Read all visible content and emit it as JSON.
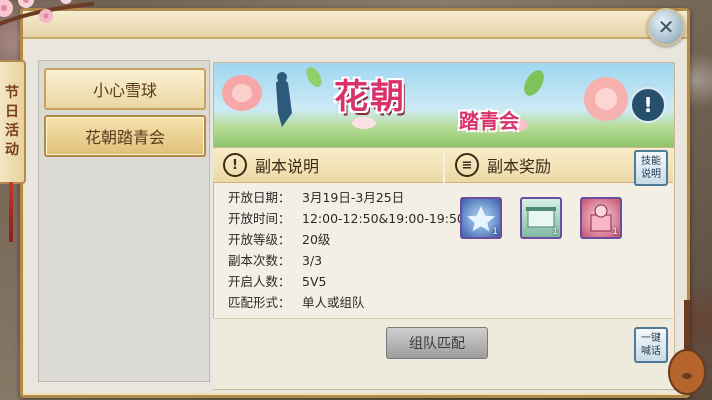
{
  "side_tab": {
    "chars": [
      "节",
      "日",
      "活",
      "动"
    ]
  },
  "list": {
    "items": [
      {
        "label": "小心雪球"
      },
      {
        "label": "花朝踏青会"
      }
    ],
    "selected_index": 1
  },
  "banner": {
    "title": "花朝",
    "subtitle": "踏青会"
  },
  "sections": {
    "description": {
      "label": "副本说明",
      "icon": "exclamation-icon"
    },
    "rewards": {
      "label": "副本奖励",
      "icon": "chest-icon"
    }
  },
  "skill_btn": {
    "label": "技能说明"
  },
  "info": [
    {
      "label": "开放日期：",
      "value": "3月19日-3月25日"
    },
    {
      "label": "开放时间：",
      "value": "12:00-12:50&19:00-19:50"
    },
    {
      "label": "开放等级：",
      "value": "20级"
    },
    {
      "label": "副本次数：",
      "value": "3/3"
    },
    {
      "label": "开启人数：",
      "value": "5V5"
    },
    {
      "label": "匹配形式：",
      "value": "单人或组队"
    }
  ],
  "rewards": [
    {
      "icon": "lotus-item-icon",
      "count": "1"
    },
    {
      "icon": "scroll-item-icon",
      "count": "1"
    },
    {
      "icon": "gift-item-icon",
      "count": "1"
    }
  ],
  "match_button": {
    "label": "组队匹配"
  },
  "quick_chat": {
    "label": "一键喊话"
  },
  "colors": {
    "accent_pink": "#d9326a",
    "frame_gold": "#b28a4c",
    "button_blue": "#4e7a98"
  }
}
